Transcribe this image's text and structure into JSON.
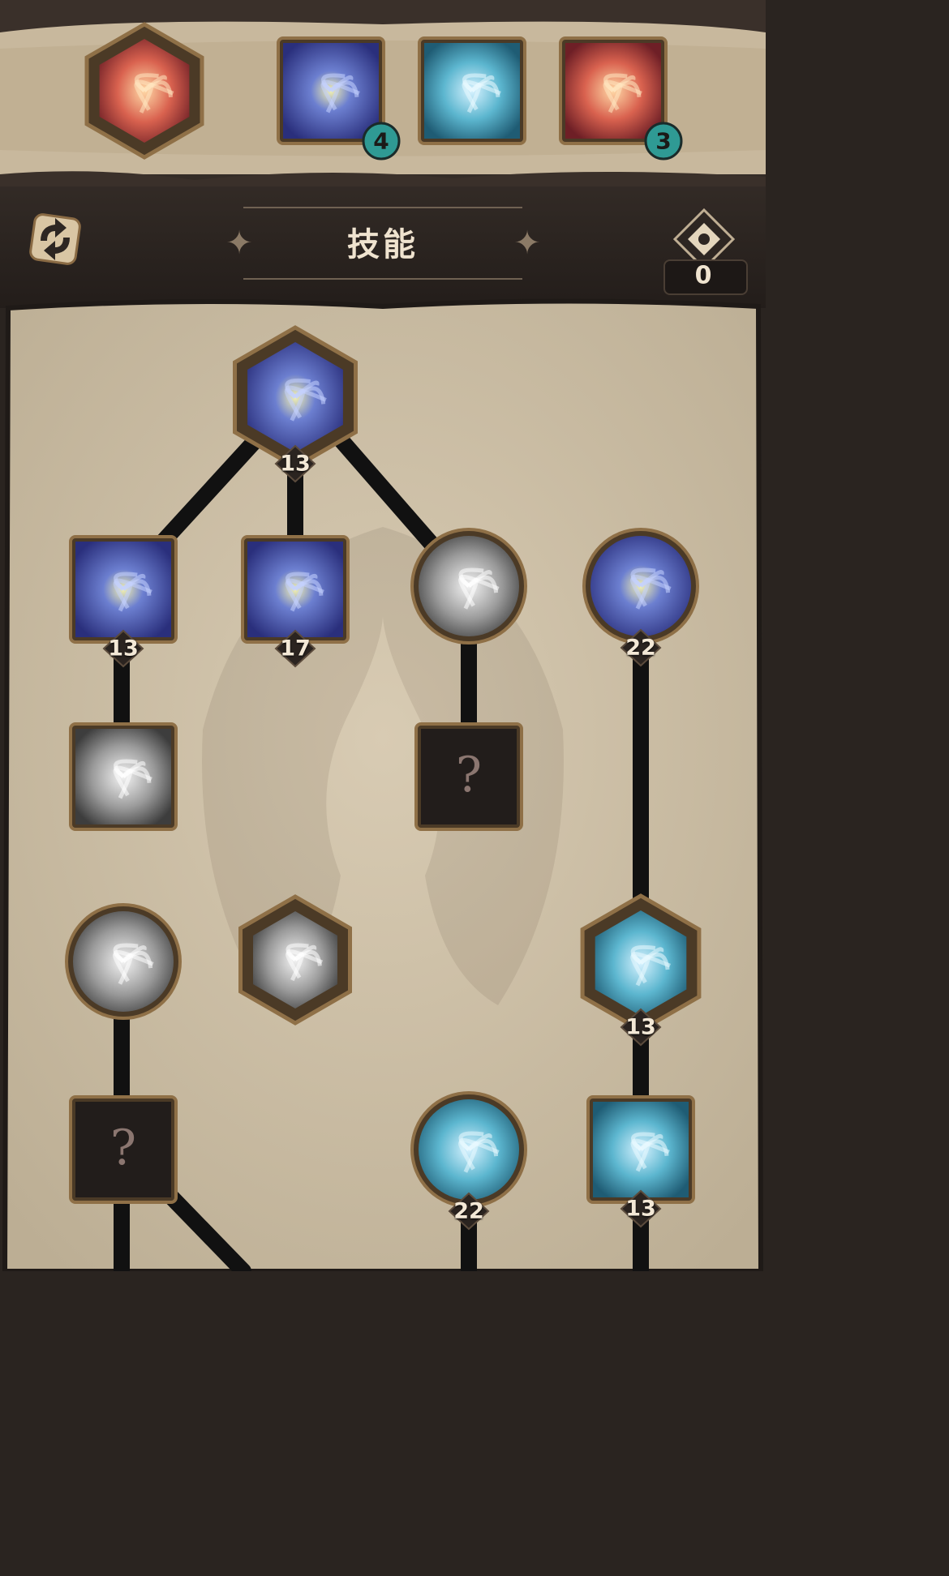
{
  "header": {
    "title": "技能",
    "skill_points": "0",
    "equipped_skills": [
      {
        "name": "red-slash-core-skill",
        "badge": null
      },
      {
        "name": "lightning-fist-skill",
        "badge": "4"
      },
      {
        "name": "ice-scythe-skill",
        "badge": null
      },
      {
        "name": "fire-swirl-skill",
        "badge": "3"
      }
    ]
  },
  "tree": {
    "root": {
      "level": "13"
    },
    "nodes": [
      {
        "id": "blue-burst",
        "level": "13"
      },
      {
        "id": "lightning-hand",
        "level": "17"
      },
      {
        "id": "shadow-swirl",
        "level": null
      },
      {
        "id": "arcane-grasp",
        "level": "22"
      },
      {
        "id": "gray-strike",
        "level": null
      },
      {
        "id": "locked-1",
        "level": null,
        "glyph": "?"
      },
      {
        "id": "gray-knight-circle",
        "level": null
      },
      {
        "id": "gray-knight-hex",
        "level": null
      },
      {
        "id": "ice-reaper-hex",
        "level": "13"
      },
      {
        "id": "locked-2",
        "level": null,
        "glyph": "?"
      },
      {
        "id": "ice-scythe-circle",
        "level": "22"
      },
      {
        "id": "ice-scythe-square",
        "level": "13"
      }
    ]
  },
  "colors": {
    "accent_badge": "#2f9a94",
    "parchment": "#cdbfa6",
    "frame": "#6b5335",
    "dark_band": "#2d2622"
  },
  "icons": [
    "cycle-icon",
    "diamond-icon",
    "question-mark-icon"
  ]
}
